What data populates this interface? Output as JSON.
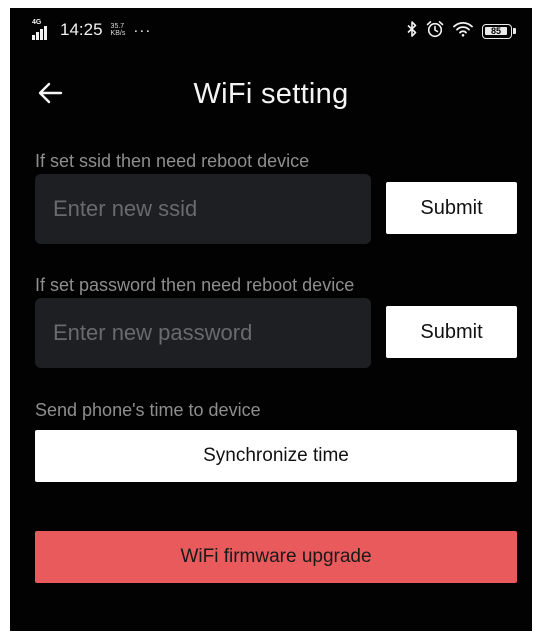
{
  "status_bar": {
    "network": "4G",
    "time": "14:25",
    "speed_value": "35.7",
    "speed_unit": "KB/s",
    "more": "···",
    "battery": "85"
  },
  "header": {
    "title": "WiFi setting"
  },
  "ssid": {
    "label": "If set ssid then need reboot device",
    "placeholder": "Enter new ssid",
    "value": "",
    "submit_label": "Submit"
  },
  "password": {
    "label": "If set password then need reboot device",
    "placeholder": "Enter new password",
    "value": "",
    "submit_label": "Submit"
  },
  "time_sync": {
    "label": "Send phone's time to device",
    "button_label": "Synchronize time"
  },
  "firmware": {
    "button_label": "WiFi firmware upgrade"
  },
  "icons": {
    "back": "arrow-left-icon",
    "signal": "cellular-signal-icon",
    "bluetooth": "bluetooth-icon",
    "alarm": "alarm-clock-icon",
    "wifi": "wifi-icon",
    "battery": "battery-icon"
  },
  "colors": {
    "background": "#020202",
    "input_background": "#1d1f22",
    "label_text": "#8e8e8e",
    "primary_button": "#ffffff",
    "accent_button": "#e85a5c"
  }
}
